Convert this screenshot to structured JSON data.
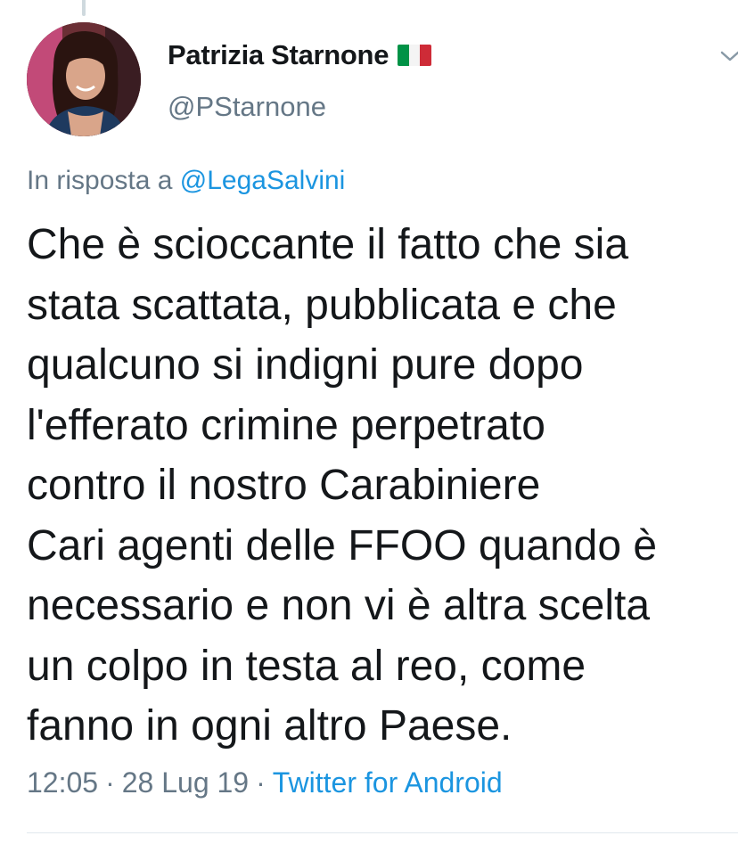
{
  "tweet": {
    "author": {
      "display_name": "Patrizia Starnone",
      "handle": "@PStarnone",
      "flag_icon": "italy-flag-icon",
      "flag_colors": [
        "#009246",
        "#ffffff",
        "#ce2b37"
      ]
    },
    "reply": {
      "prefix": "In risposta a",
      "mention": "@LegaSalvini"
    },
    "text_lines": [
      "Che è scioccante il fatto che sia",
      "stata scattata, pubblicata e che",
      "qualcuno si indigni pure dopo",
      "l'efferato crimine perpetrato",
      "contro il nostro Carabiniere",
      "Cari agenti delle FFOO quando è",
      "necessario e non vi è altra scelta",
      "un colpo in testa al reo, come",
      "fanno in ogni altro Paese."
    ],
    "meta": {
      "time": "12:05",
      "separator": "·",
      "date": "28 Lug 19",
      "source": "Twitter for Android"
    }
  },
  "colors": {
    "text_primary": "#14171a",
    "text_secondary": "#657786",
    "link": "#1b95e0",
    "divider": "#e1e8ed"
  }
}
